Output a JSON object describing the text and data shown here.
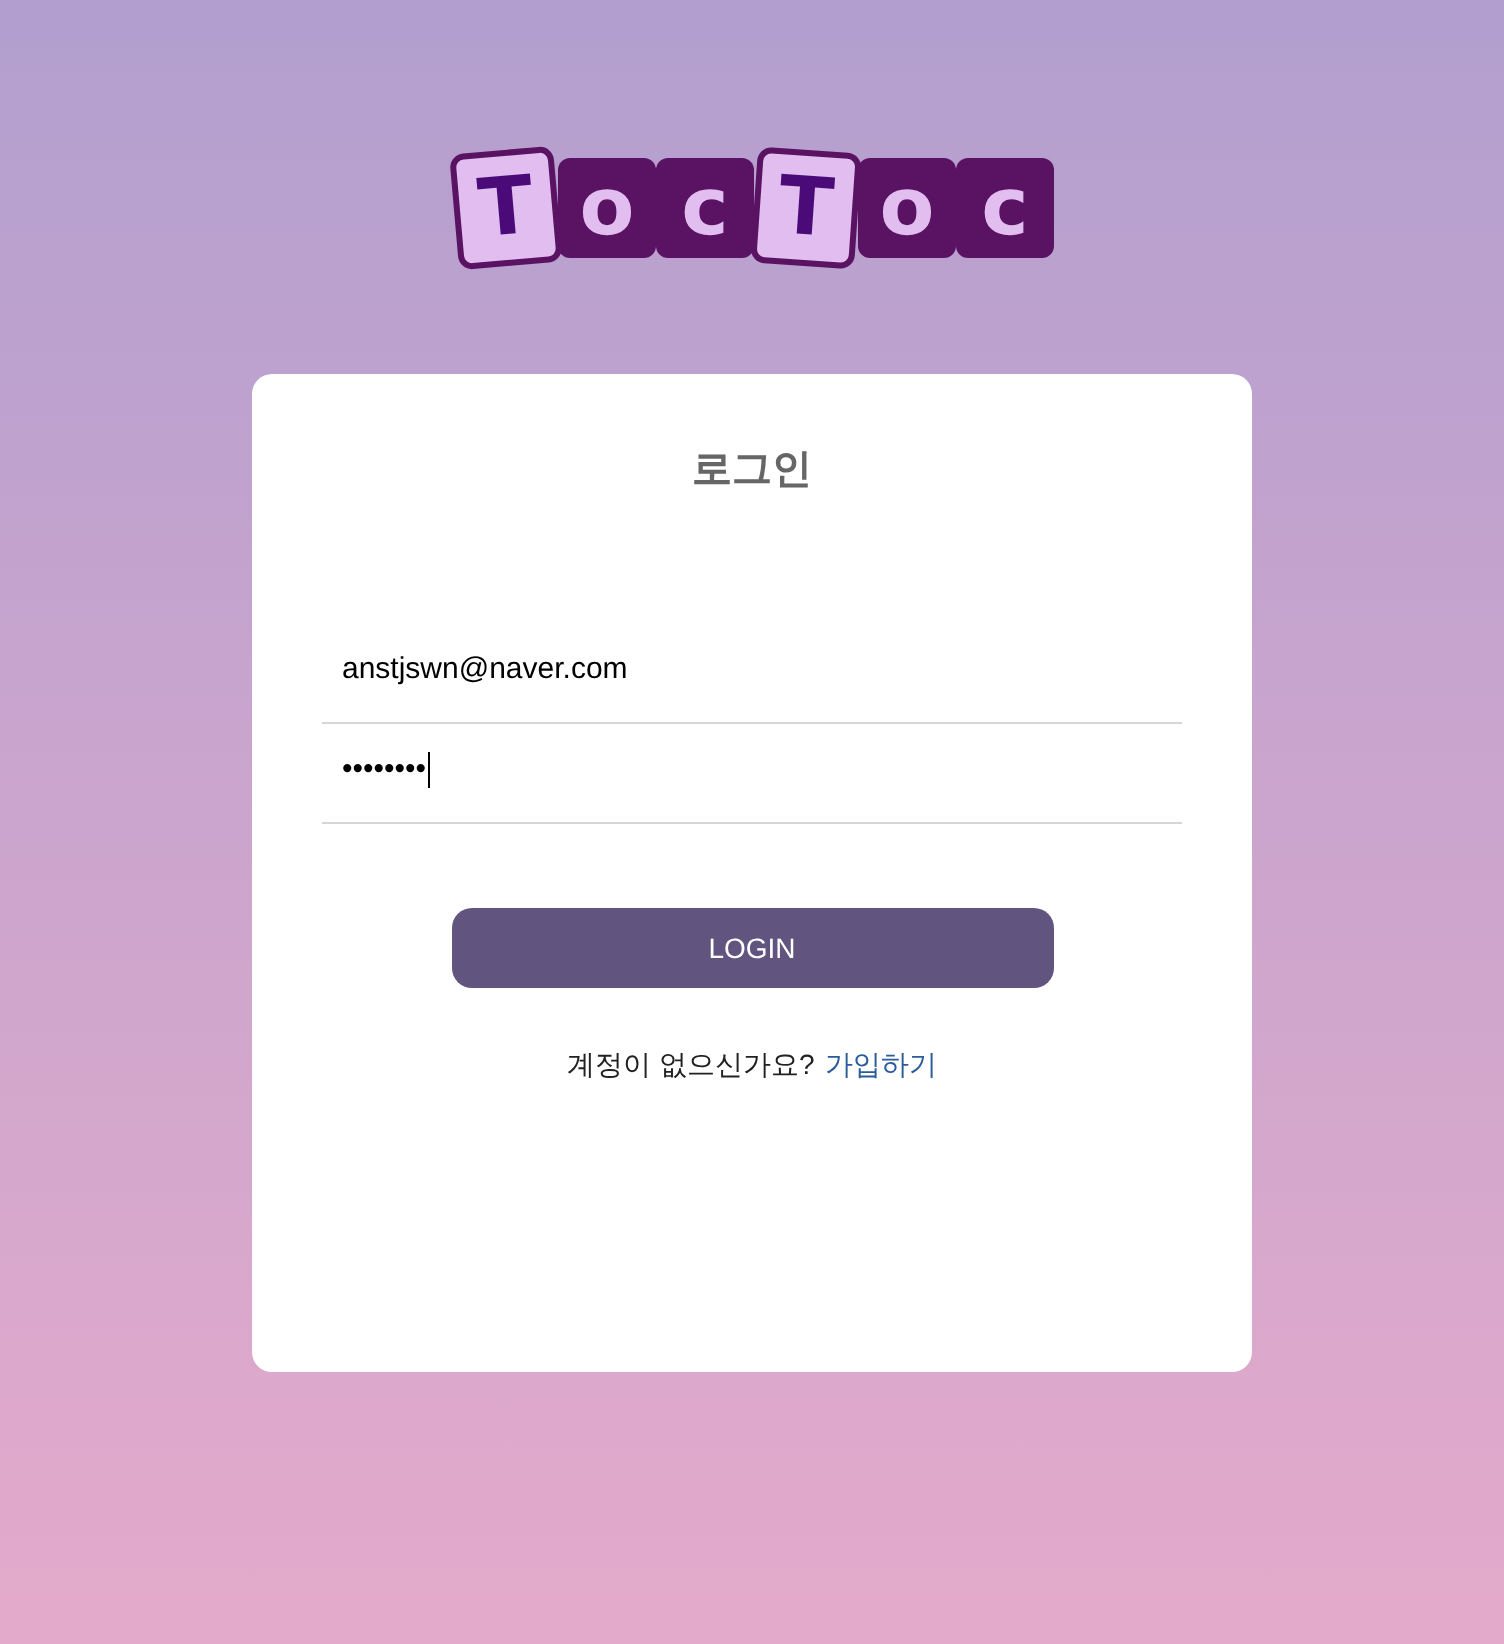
{
  "logo": {
    "tiles": [
      {
        "letter": "T",
        "kind": "light"
      },
      {
        "letter": "o",
        "kind": "dark"
      },
      {
        "letter": "c",
        "kind": "dark"
      },
      {
        "letter": "T",
        "kind": "light"
      },
      {
        "letter": "o",
        "kind": "dark"
      },
      {
        "letter": "c",
        "kind": "dark"
      }
    ]
  },
  "card": {
    "title": "로그인",
    "fields": [
      {
        "value": "anstjswn@naver.com",
        "focused": false
      },
      {
        "value": "••••••••",
        "focused": true
      }
    ],
    "button": "LOGIN",
    "signup": {
      "prompt": "계정이 없으신가요?",
      "link": "가입하기"
    }
  }
}
